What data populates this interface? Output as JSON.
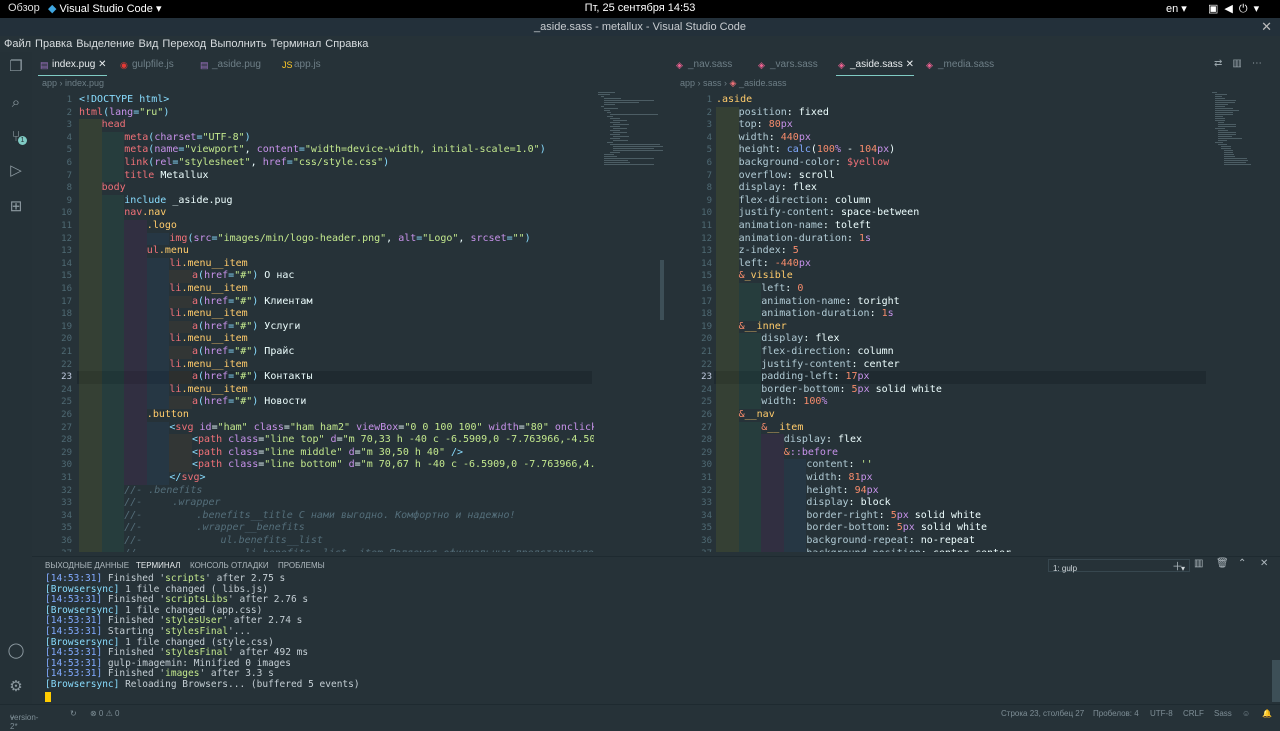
{
  "system": {
    "overview": "Обзор",
    "app_name": "Visual Studio Code",
    "clock": "Пт, 25 сентября  14:53",
    "language": "en"
  },
  "window": {
    "title": "_aside.sass - metallux - Visual Studio Code"
  },
  "menu": [
    "Файл",
    "Правка",
    "Выделение",
    "Вид",
    "Переход",
    "Выполнить",
    "Терминал",
    "Справка"
  ],
  "left_editor": {
    "tabs": [
      "index.pug",
      "gulpfile.js",
      "_aside.pug",
      "app.js"
    ],
    "breadcrumb": [
      "app",
      "index.pug"
    ],
    "current_line": 23
  },
  "right_editor": {
    "tabs": [
      "_nav.sass",
      "_vars.sass",
      "_aside.sass",
      "_media.sass"
    ],
    "breadcrumb": [
      "app",
      "sass",
      "_aside.sass"
    ],
    "current_line": 23
  },
  "panel": {
    "tabs": [
      "ВЫХОДНЫЕ ДАННЫЕ",
      "ТЕРМИНАЛ",
      "КОНСОЛЬ ОТЛАДКИ",
      "ПРОБЛЕМЫ"
    ],
    "terminal_select": "1: gulp",
    "terminal_lines": [
      "[14:53:31] Finished 'scripts' after 2.75 s",
      "[Browsersync] 1 file changed ( libs.js)",
      "[14:53:31] Finished 'scriptsLibs' after 2.76 s",
      "[Browsersync] 1 file changed (app.css)",
      "[14:53:31] Finished 'stylesUser' after 2.74 s",
      "[14:53:31] Starting 'stylesFinal'...",
      "[Browsersync] 1 file changed (style.css)",
      "[14:53:31] Finished 'stylesFinal' after 492 ms",
      "[14:53:31] gulp-imagemin: Minified 0 images",
      "[14:53:31] Finished 'images' after 3.3 s",
      "[Browsersync] Reloading Browsers... (buffered 5 events)"
    ]
  },
  "status": {
    "branch": "version-2*",
    "sync": "↻",
    "problems": "⊗ 0 ⚠ 0",
    "position": "Строка 23, столбец 27",
    "spaces": "Пробелов: 4",
    "encoding": "UTF-8",
    "eol": "CRLF",
    "language": "Sass"
  }
}
